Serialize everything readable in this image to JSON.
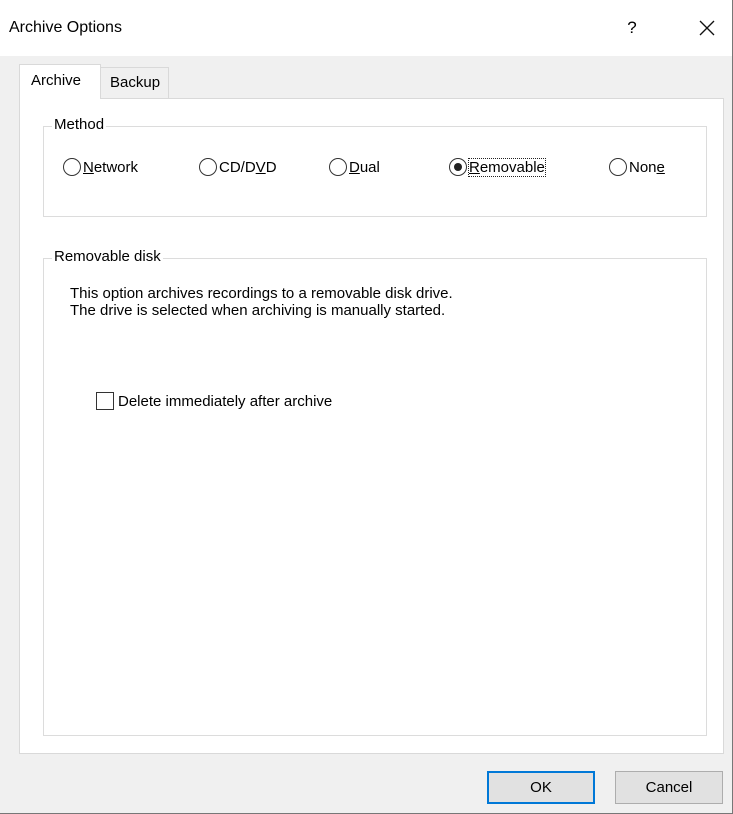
{
  "window": {
    "title": "Archive Options",
    "help_label": "?",
    "close_icon": "close-icon"
  },
  "tabs": [
    {
      "label": "Archive",
      "selected": true
    },
    {
      "label": "Backup",
      "selected": false
    }
  ],
  "method": {
    "legend": "Method",
    "options": [
      {
        "pre": "",
        "accel": "N",
        "post": "etwork",
        "checked": false
      },
      {
        "pre": "CD/D",
        "accel": "V",
        "post": "D",
        "checked": false
      },
      {
        "pre": "",
        "accel": "D",
        "post": "ual",
        "checked": false
      },
      {
        "pre": "",
        "accel": "R",
        "post": "emovable",
        "checked": true
      },
      {
        "pre": "Non",
        "accel": "e",
        "post": "",
        "checked": false
      }
    ]
  },
  "removable": {
    "legend": "Removable disk",
    "desc_line1": "This option archives recordings to a removable disk drive.",
    "desc_line2": "The drive is selected when archiving is manually started.",
    "checkbox_label": "Delete immediately after archive",
    "checkbox_checked": false
  },
  "buttons": {
    "ok": "OK",
    "cancel": "Cancel"
  }
}
